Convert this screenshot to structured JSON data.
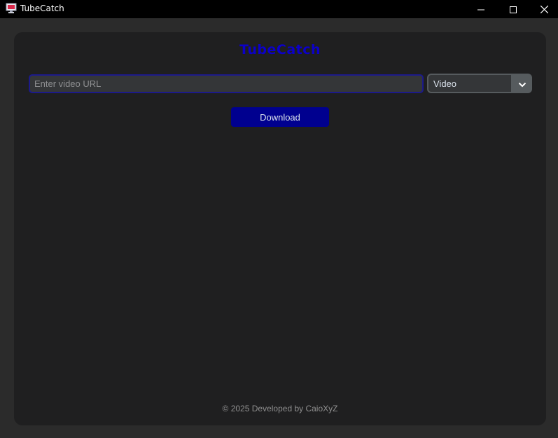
{
  "window": {
    "title": "TubeCatch",
    "icon": "app-monitor-icon",
    "controls": {
      "minimize_icon": "minimize-icon",
      "maximize_icon": "maximize-icon",
      "close_icon": "close-icon"
    }
  },
  "app": {
    "heading": "TubeCatch",
    "heading_color": "#0c00c9"
  },
  "url_input": {
    "value": "",
    "placeholder": "Enter video URL",
    "border_color": "#1c1a8a"
  },
  "format_select": {
    "selected": "Video",
    "icon": "chevron-down-icon"
  },
  "download_button": {
    "label": "Download",
    "color": "#00008f"
  },
  "footer": {
    "text": "© 2025 Developed by CaioXyZ"
  }
}
